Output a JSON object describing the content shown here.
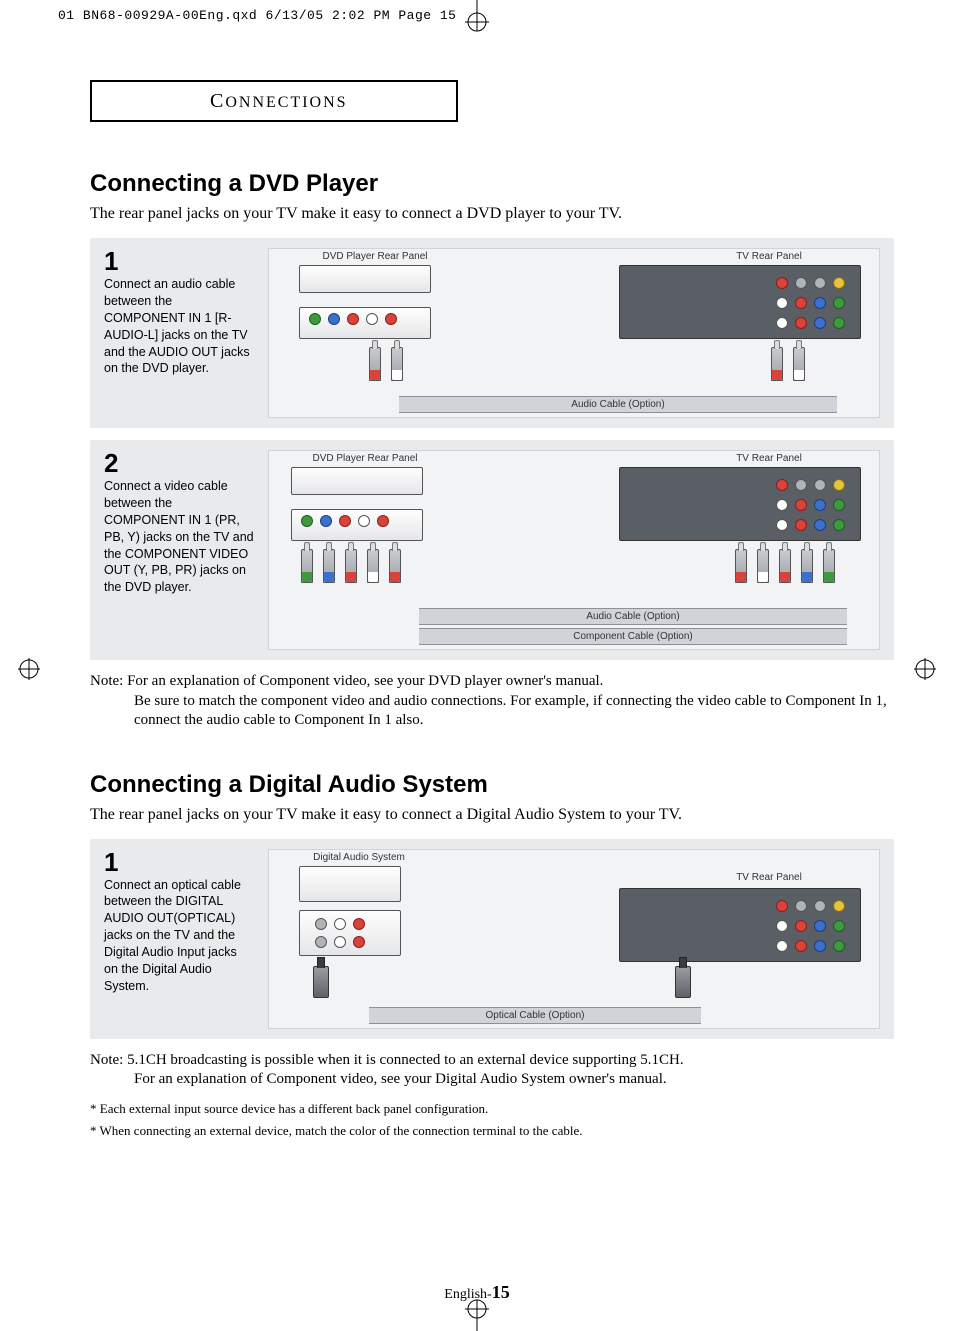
{
  "slug": "01 BN68-00929A-00Eng.qxd  6/13/05 2:02 PM  Page 15",
  "tab_label": "CONNECTIONS",
  "sections": {
    "dvd": {
      "title": "Connecting a DVD Player",
      "intro": "The rear panel jacks on your TV make it easy to connect a DVD player to your TV.",
      "step1": {
        "num": "1",
        "text": "Connect an audio cable between the COMPONENT IN 1 [R-AUDIO-L] jacks on the TV and the AUDIO OUT jacks on the DVD player.",
        "label_dvd": "DVD Player Rear Panel",
        "label_tv": "TV Rear Panel",
        "cable_label": "Audio Cable (Option)"
      },
      "step2": {
        "num": "2",
        "text": "Connect a video cable between the COMPONENT IN 1 (PR, PB, Y) jacks on the TV and the COMPONENT VIDEO OUT (Y, PB, PR) jacks on the DVD player.",
        "label_dvd": "DVD Player Rear Panel",
        "label_tv": "TV Rear Panel",
        "cable_label_audio": "Audio Cable (Option)",
        "cable_label_comp": "Component Cable (Option)"
      },
      "note_label": "Note:",
      "note_line1": "For an explanation of Component video, see your DVD player owner's manual.",
      "note_line2": "Be sure to match the component video and audio connections. For example, if connecting the video cable to Component In 1, connect the audio cable to Component In 1 also."
    },
    "das": {
      "title": "Connecting a Digital Audio System",
      "intro": "The rear panel jacks on your TV make it easy to connect a Digital Audio System to your TV.",
      "step1": {
        "num": "1",
        "text": "Connect an optical cable between the DIGITAL  AUDIO OUT(OPTICAL) jacks on the TV and the Digital Audio Input jacks on the Digital Audio System.",
        "label_das": "Digital Audio System",
        "label_tv": "TV Rear Panel",
        "cable_label": "Optical Cable (Option)"
      },
      "note_label": "Note:",
      "note_line1": "5.1CH broadcasting is possible when it is connected to an external device supporting 5.1CH.",
      "note_line2": "For an explanation of Component video, see your Digital Audio System owner's manual."
    }
  },
  "footnote1": "* Each external input source device has a different back panel configuration.",
  "footnote2": "* When connecting an external device, match the color of the connection terminal to the cable.",
  "page_prefix": "English-",
  "page_number": "15"
}
